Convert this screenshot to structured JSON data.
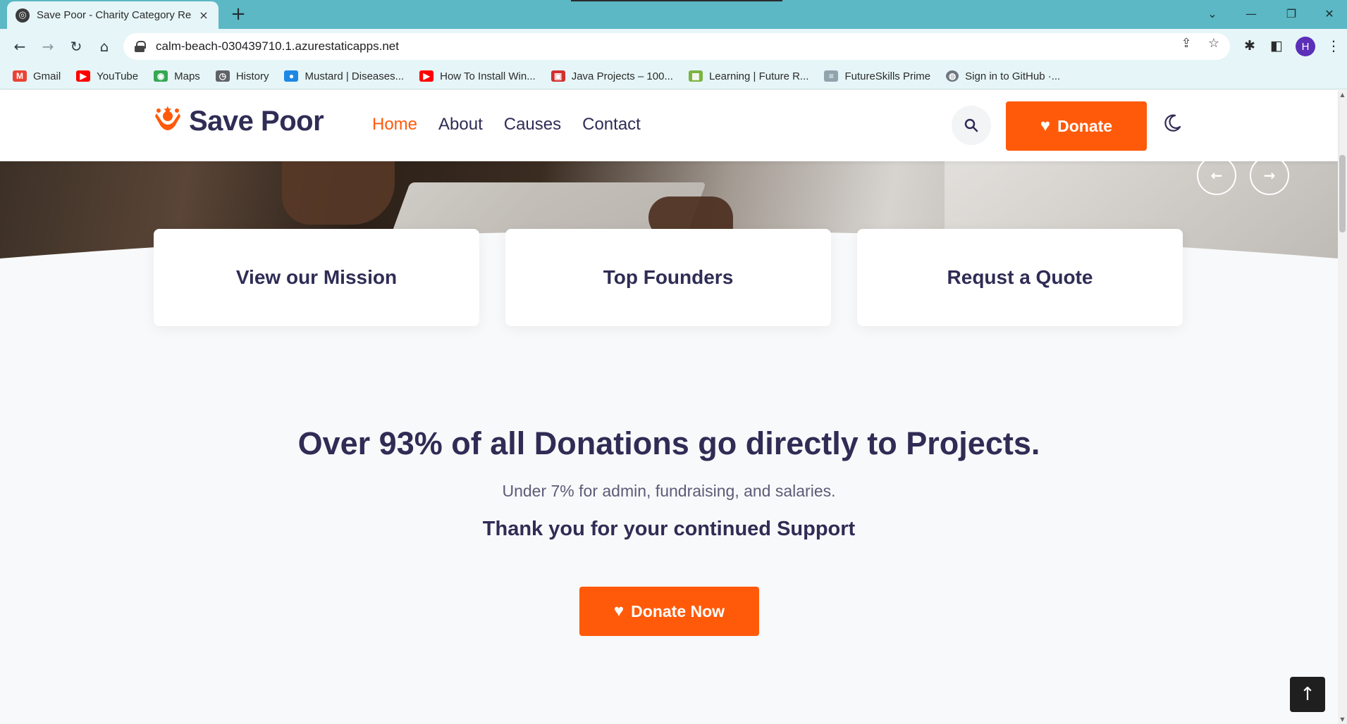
{
  "browser": {
    "tab": {
      "title": "Save Poor - Charity Category Res",
      "close_glyph": "×"
    },
    "new_tab_glyph": "+",
    "window_controls": {
      "dropdown": "⌄",
      "minimize": "—",
      "restore": "❐",
      "close": "✕"
    },
    "toolbar": {
      "back": "←",
      "forward": "→",
      "reload": "↻",
      "home": "⌂"
    },
    "url": "calm-beach-030439710.1.azurestaticapps.net",
    "omnibox_icons": {
      "share": "⇪",
      "bookmark": "☆"
    },
    "extensions": {
      "puzzle": "✱",
      "sidepanel": "◧"
    },
    "profile_initial": "H",
    "menu_glyph": "⋮",
    "bookmarks": [
      {
        "label": "Gmail",
        "icon": "gmail-icon",
        "color": "#ea4335",
        "glyph": "M"
      },
      {
        "label": "YouTube",
        "icon": "youtube-icon",
        "color": "#ff0000",
        "glyph": "▶"
      },
      {
        "label": "Maps",
        "icon": "maps-icon",
        "color": "#34a853",
        "glyph": "◉"
      },
      {
        "label": "History",
        "icon": "history-icon",
        "color": "#5f6368",
        "glyph": "◷"
      },
      {
        "label": "Mustard | Diseases...",
        "icon": "mustard-icon",
        "color": "#1e88e5",
        "glyph": "●"
      },
      {
        "label": "How To Install Win...",
        "icon": "youtube-icon",
        "color": "#ff0000",
        "glyph": "▶"
      },
      {
        "label": "Java Projects – 100...",
        "icon": "java-projects-icon",
        "color": "#d32f2f",
        "glyph": "▣"
      },
      {
        "label": "Learning | Future R...",
        "icon": "learning-icon",
        "color": "#7cb342",
        "glyph": "▦"
      },
      {
        "label": "FutureSkills Prime",
        "icon": "futureskills-icon",
        "color": "#90a4ae",
        "glyph": "≡"
      },
      {
        "label": "Sign in to GitHub ·...",
        "icon": "github-icon",
        "color": "#6e7681",
        "glyph": "◍"
      }
    ]
  },
  "site": {
    "logo_text": "Save Poor",
    "nav": [
      {
        "label": "Home",
        "active": true
      },
      {
        "label": "About",
        "active": false
      },
      {
        "label": "Causes",
        "active": false
      },
      {
        "label": "Contact",
        "active": false
      }
    ],
    "donate_label": "Donate",
    "slider": {
      "prev_glyph": "←",
      "next_glyph": "→"
    },
    "features": [
      {
        "title": "View our Mission"
      },
      {
        "title": "Top Founders"
      },
      {
        "title": "Requst a Quote"
      }
    ],
    "headline": "Over 93% of all Donations go directly to Projects.",
    "subline": "Under 7% for admin, fundraising, and salaries.",
    "thanks": "Thank you for your continued Support",
    "donate_now_label": "Donate Now",
    "back_to_top_glyph": "↑",
    "colors": {
      "brand_orange": "#ff5a0a",
      "heading_navy": "#2f2c55",
      "chrome_teal": "#5bb8c4"
    }
  }
}
